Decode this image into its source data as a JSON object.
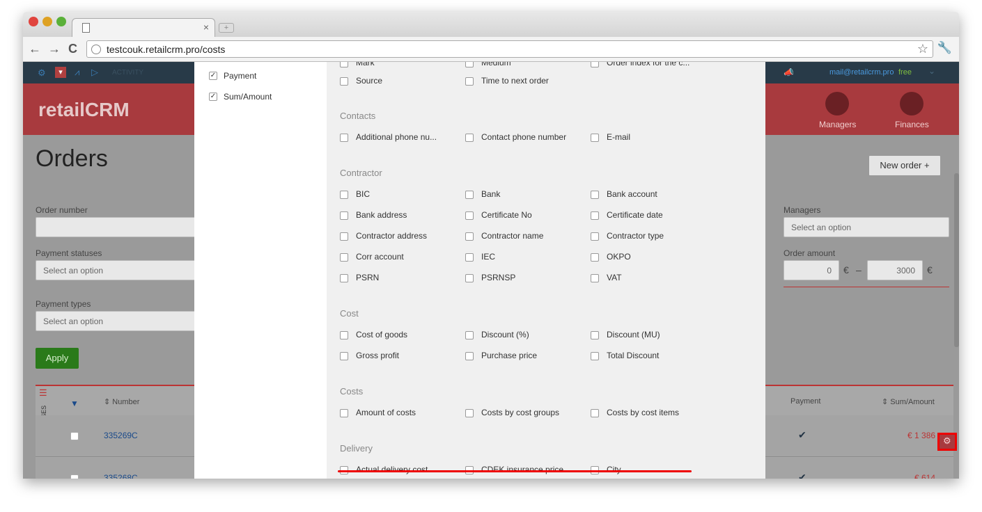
{
  "browser": {
    "url": "testcouk.retailcrm.pro/costs",
    "tab_close": "×"
  },
  "header": {
    "topbar_activity": "ACTIVITY",
    "email": "mail@retailcrm.pro",
    "plan": "free",
    "logo": "retailCRM",
    "nav": [
      "Managers",
      "Finances"
    ]
  },
  "page": {
    "title": "Orders",
    "new_order": "New order +",
    "filters": {
      "order_number_label": "Order number",
      "payment_statuses_label": "Payment statuses",
      "payment_statuses_placeholder": "Select an option",
      "payment_types_label": "Payment types",
      "payment_types_placeholder": "Select an option",
      "managers_label": "Managers",
      "managers_placeholder": "Select an option",
      "order_amount_label": "Order amount",
      "amount_from": "0",
      "amount_to": "3000",
      "currency": "€",
      "dash": "–"
    },
    "apply": "Apply",
    "table": {
      "statuses": "STATUSES",
      "col_number": "⇕ Number",
      "col_payment": "Payment",
      "col_sum": "⇕ Sum/Amount",
      "rows": [
        {
          "number": "335269C",
          "sum": "€ 1 386"
        },
        {
          "number": "335268C",
          "sum": "€ 614"
        }
      ]
    }
  },
  "modal": {
    "left_options": [
      {
        "label": "Payment",
        "checked": true
      },
      {
        "label": "Sum/Amount",
        "checked": true
      }
    ],
    "top_partial": [
      "Mark",
      "Medium",
      "Order index for the c..."
    ],
    "top_row": [
      "Source",
      "Time to next order"
    ],
    "sections": [
      {
        "title": "Contacts",
        "rows": [
          [
            "Additional phone nu...",
            "Contact phone number",
            "E-mail"
          ]
        ]
      },
      {
        "title": "Contractor",
        "rows": [
          [
            "BIC",
            "Bank",
            "Bank account"
          ],
          [
            "Bank address",
            "Certificate No",
            "Certificate date"
          ],
          [
            "Contractor address",
            "Contractor name",
            "Contractor type"
          ],
          [
            "Corr account",
            "IEC",
            "OKPO"
          ],
          [
            "PSRN",
            "PSRNSP",
            "VAT"
          ]
        ]
      },
      {
        "title": "Cost",
        "rows": [
          [
            "Cost of goods",
            "Discount (%)",
            "Discount (MU)"
          ],
          [
            "Gross profit",
            "Purchase price",
            "Total Discount"
          ]
        ]
      },
      {
        "title": "Costs",
        "rows": [
          [
            "Amount of costs",
            "Costs by cost groups",
            "Costs by cost items"
          ]
        ]
      },
      {
        "title": "Delivery",
        "rows": [
          [
            "Actual delivery cost",
            "CDEK insurance price",
            "City"
          ]
        ]
      }
    ]
  },
  "colors": {
    "accent_red": "#a83a3e",
    "highlight": "#e00000",
    "apply_green": "#2a7a1a"
  }
}
